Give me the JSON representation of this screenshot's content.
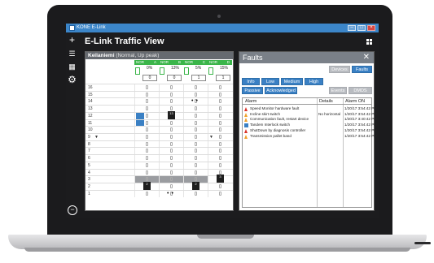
{
  "window": {
    "title": "KONE E-Link"
  },
  "app": {
    "title": "E-Link Traffic View"
  },
  "sidebar": {
    "add_icon": "+",
    "menu_icon": "☰",
    "apps_icon": "▦",
    "settings_icon": "⚙",
    "exit_icon": "−"
  },
  "traffic": {
    "site_name": "Keilaniemi",
    "mode": "(Normal, Up peak)",
    "cars": [
      {
        "status": "NOR",
        "id": "A",
        "load": "0%",
        "count": "0"
      },
      {
        "status": "NOR",
        "id": "B",
        "load": "13%",
        "count": "0"
      },
      {
        "status": "NOR",
        "id": "C",
        "load": "5%",
        "count": "1"
      },
      {
        "status": "NOR",
        "id": "D",
        "load": "15%",
        "count": "1"
      }
    ],
    "floors": [
      "16",
      "15",
      "14",
      "13",
      "12",
      "11",
      "10",
      "9",
      "8",
      "7",
      "6",
      "5",
      "4",
      "3",
      "2",
      "1"
    ],
    "floor_9_arrow": "▼",
    "car_d_floor_9_arrow": "▼",
    "car_badges": {
      "b12": "13",
      "a2": "2",
      "c2": "2",
      "d3": "3"
    }
  },
  "faults": {
    "title": "Faults",
    "close_icon": "✕",
    "buttons": {
      "devices": "Devices",
      "faults": "Faults",
      "info": "Info",
      "low": "Low",
      "medium": "Medium",
      "high": "High",
      "passive": "Passive",
      "acknowledged": "Acknowledged",
      "events": "Events",
      "dmds_faults": "DMDS Faults"
    },
    "columns": {
      "alarm": "Alarm",
      "details": "Details",
      "alarm_on": "Alarm ON"
    },
    "rows": [
      {
        "severity": "high",
        "alarm": "Speed Monitor hardware fault",
        "details": "",
        "time": "1/20/17  3:54:42 PM"
      },
      {
        "severity": "medium",
        "alarm": "Incline skirt switch",
        "details": "No horizontal",
        "time": "1/20/17  3:54:42 PM"
      },
      {
        "severity": "medium",
        "alarm": "Communication fault, restart device",
        "details": "",
        "time": "1/20/17  3:40:42 PM"
      },
      {
        "severity": "info",
        "alarm": "Tandem Interlock switch",
        "details": "",
        "time": "1/20/17  3:54:42 PM"
      },
      {
        "severity": "high",
        "alarm": "ShutDown by diagnosis controller",
        "details": "",
        "time": "1/20/17  3:54:42 PM"
      },
      {
        "severity": "medium",
        "alarm": "Transmission pallet band",
        "details": "",
        "time": "1/20/17  3:54:42 PM"
      }
    ]
  },
  "colors": {
    "accent": "#3a80c4",
    "car_status": "#3bb54a",
    "severity_high": "#d9342b",
    "severity_medium": "#f0a22c"
  }
}
